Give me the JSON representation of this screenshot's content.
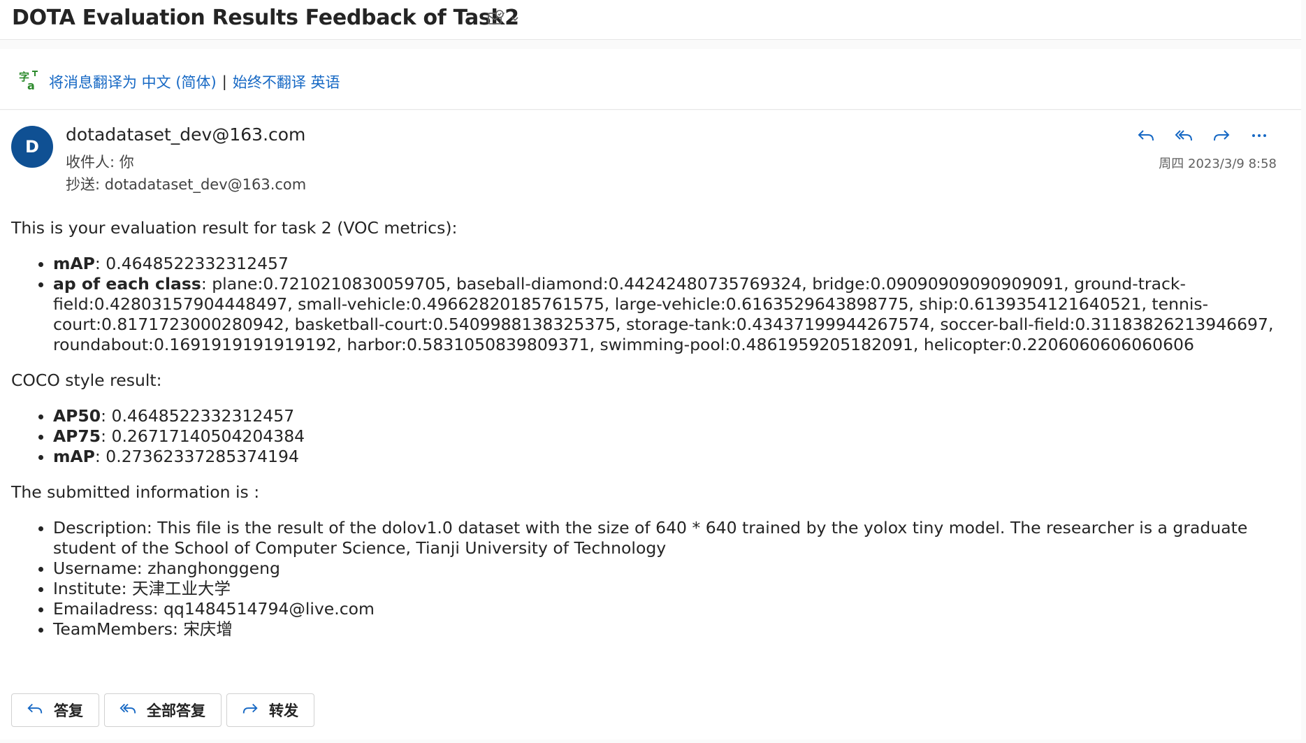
{
  "subject": {
    "title": "DOTA Evaluation Results Feedback of Task2",
    "tools_icon": "mail-checkmark-icon",
    "dropdown_icon": "chevron-down-icon"
  },
  "translate": {
    "icon": "translate-icon",
    "link_translate": "将消息翻译为 中文 (简体)",
    "separator": "|",
    "link_never": "始终不翻译 英语"
  },
  "message": {
    "avatar_letter": "D",
    "avatar_color": "#0f5093",
    "sender": "dotadataset_dev@163.com",
    "to_label": "收件人:",
    "to_value": "你",
    "cc_label": "抄送:",
    "cc_value": "dotadataset_dev@163.com",
    "date": "周四 2023/3/9 8:58",
    "actions": [
      "reply-icon",
      "reply-all-icon",
      "forward-icon",
      "more-icon"
    ],
    "intro": "This is your evaluation result for task 2 (VOC metrics):",
    "voc": [
      {
        "label": "mAP",
        "value": ": 0.4648522332312457"
      },
      {
        "label": "ap of each class",
        "value": ": plane:0.7210210830059705, baseball-diamond:0.44242480735769324, bridge:0.09090909090909091, ground-track-field:0.42803157904448497, small-vehicle:0.49662820185761575, large-vehicle:0.6163529643898775, ship:0.6139354121640521, tennis-court:0.8171723000280942, basketball-court:0.5409988138325375, storage-tank:0.43437199944267574, soccer-ball-field:0.31183826213946697, roundabout:0.1691919191919192, harbor:0.5831050839809371, swimming-pool:0.4861959205182091, helicopter:0.2206060606060606"
      }
    ],
    "coco_title": "COCO style result:",
    "coco": [
      {
        "label": "AP50",
        "value": ": 0.4648522332312457"
      },
      {
        "label": "AP75",
        "value": ": 0.26717140504204384"
      },
      {
        "label": "mAP",
        "value": ": 0.27362337285374194"
      }
    ],
    "submitted_title": "The submitted information is :",
    "submitted": [
      "Description: This file is the result of the dolov1.0 dataset with the size of 640 * 640 trained by the yolox tiny model. The researcher is a graduate student of the School of Computer Science, Tianji University of Technology",
      "Username: zhanghonggeng",
      "Institute: 天津工业大学",
      "Emailadress: qq1484514794@live.com",
      "TeamMembers: 宋庆增"
    ],
    "buttons": {
      "reply": "答复",
      "reply_all": "全部答复",
      "forward": "转发"
    }
  }
}
